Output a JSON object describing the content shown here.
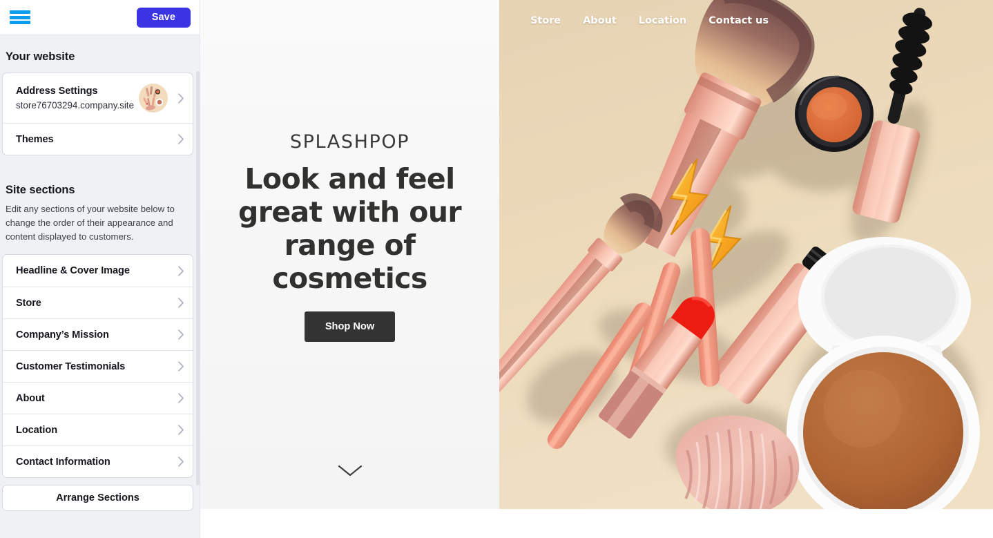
{
  "sidebar": {
    "topbar": {
      "menu_icon": "hamburger-menu-icon",
      "save_label": "Save"
    },
    "website_heading": "Your website",
    "website_items": [
      {
        "title": "Address Settings",
        "subtitle": "store76703294.company.site",
        "has_thumb": true
      },
      {
        "title": "Themes",
        "subtitle": "",
        "has_thumb": false
      }
    ],
    "sections_heading": "Site sections",
    "sections_description": "Edit any sections of your website below to change the order of their appearance and content displayed to customers.",
    "sections": [
      {
        "label": "Headline & Cover Image"
      },
      {
        "label": "Store"
      },
      {
        "label": "Company’s Mission"
      },
      {
        "label": "Customer Testimonials"
      },
      {
        "label": "About"
      },
      {
        "label": "Location"
      },
      {
        "label": "Contact Information"
      }
    ],
    "arrange_label": "Arrange Sections"
  },
  "preview": {
    "topnav": [
      {
        "label": "Store"
      },
      {
        "label": "About"
      },
      {
        "label": "Location"
      },
      {
        "label": "Contact us"
      }
    ],
    "brand": "SPLASHPOP",
    "headline": "Look and feel great with our range of cosmetics",
    "cta_label": "Shop Now",
    "scroll_icon": "chevron-down-icon",
    "cover_image_alt": "flat-lay of cosmetics: makeup brushes, lightning-bolt earrings, blush pot, mascara, lipstick, compact powder and pink velvet scrunchie on a beige background"
  },
  "colors": {
    "accent_save": "#3a34e4",
    "menu_blue": "#0b9cf0",
    "sidebar_bg": "#f0f1f5",
    "cta_dark": "#333333",
    "cover_bg": "#ead9bd"
  }
}
